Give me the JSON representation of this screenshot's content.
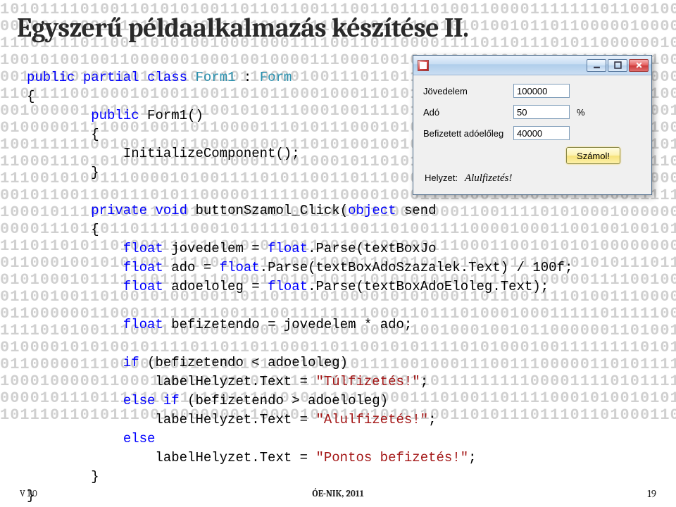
{
  "slide": {
    "title": "Egyszerű példaalkalmazás készítése II."
  },
  "code": {
    "l1_a": "public",
    "l1_b": "partial",
    "l1_c": "class",
    "l1_d": "Form1",
    "l1_e": "Form",
    "l2": "{",
    "l3_a": "public",
    "l3_b": " Form1()",
    "l4": "        {",
    "l5": "            InitializeComponent();",
    "l6": "        }",
    "l7": "",
    "l8_a": "private",
    "l8_b": "void",
    "l8_c": " buttonSzamol_Click(",
    "l8_d": "object",
    "l8_e": " send",
    "l9": "        {",
    "l10_a": "float",
    "l10_b": " jovedelem = ",
    "l10_c": "float",
    "l10_d": ".Parse(textBoxJo",
    "l11_a": "float",
    "l11_b": " ado = ",
    "l11_c": "float",
    "l11_d": ".Parse(textBoxAdoSzazalek.Text) / 100f;",
    "l12_a": "float",
    "l12_b": " adoeloleg = ",
    "l12_c": "float",
    "l12_d": ".Parse(textBoxAdoEloleg.Text);",
    "l13": "",
    "l14_a": "float",
    "l14_b": " befizetendo = jovedelem * ado;",
    "l15": "",
    "l16_a": "if",
    "l16_b": " (befizetendo < adoeloleg)",
    "l17_a": "                labelHelyzet.Text = ",
    "l17_b": "\"Túlfizetés!\"",
    "l17_c": ";",
    "l18_a": "else",
    "l18_b": "if",
    "l18_c": " (befizetendo > adoeloleg)",
    "l19_a": "                labelHelyzet.Text = ",
    "l19_b": "\"Alulfizetés!\"",
    "l19_c": ";",
    "l20_a": "else",
    "l21_a": "                labelHelyzet.Text = ",
    "l21_b": "\"Pontos befizetés!\"",
    "l21_c": ";",
    "l22": "        }",
    "l23": "}"
  },
  "window": {
    "titlebar_empty": "",
    "labels": {
      "jovedelem": "Jövedelem",
      "ado": "Adó",
      "ado_suffix": "%",
      "eloleg": "Befizetett adóelőleg"
    },
    "inputs": {
      "jovedelem": "100000",
      "ado": "50",
      "eloleg": "40000"
    },
    "button_calc": "Számol!",
    "status_label": "Helyzet:",
    "status_value": "Alulfizetés!"
  },
  "footer": {
    "version": "V 1.0",
    "center": "ÓE-NIK, 2011",
    "page": "19"
  },
  "bg_binary": "101011110100110101010011011011001110011011101001100001111111011001000100101\n000001100010101000110011010111111011101111101010100101101100000100000000011\n111011110110011010100100010001111001101100001111011011101011000000101010111\n100101001001100000010001001000011100010010101011000101100011100011001100111\n001001001001001011101110110000100111011011111101111011101100111010001111000\n110111100100010100110011010110001000110101101100001100011011000101001010100\n001000001101011101101001010111000100111101000110111011001000111100010000110\n010000011110001001101100001110101110001010010000000010010010101111000010111\n100111111001001100110001010011101010010010111001011011010001110101011001110\n110001110101001101111100001100100010110101101110011010000010001101101000100\n111001010011100001010011110101100110111000010110101011001011001100000110010\n001011001100111010110000011111001100001000111100010100110111000111110001101\n100010111010001111010110000010011010111000100011001111010100010000001001111\n000011101101101111100010111110101110011010011110000100011001001001011110110\n111011010110100011111101010110110011010000011100011001010101000000000010110\n011000100101010011110010111010011000110101011010100111010010101110110011101\n010100010111111011111101001101011011101010101001111101000001111001001010110\n011001001101001010010011011011010100001010100011011001111010011100001010111\n011000000110001111111100111001111111100011011101000100011111011111000111010\n111101010011100011010001100010001001000011001000100101100000011010011101100\n010000101010010111101101101100011011001010111101010001001111111101011101011\n011000001110000110011101101111100010111100100011100111000001101011111110111\n100010000011000100000101001011111100001001101111111110000111101011111001001\n000010111011111101111101111101011101110001110100110111100010100101011001100\n101110110101110010000000110000100011010101100110101110111011010001100110010"
}
